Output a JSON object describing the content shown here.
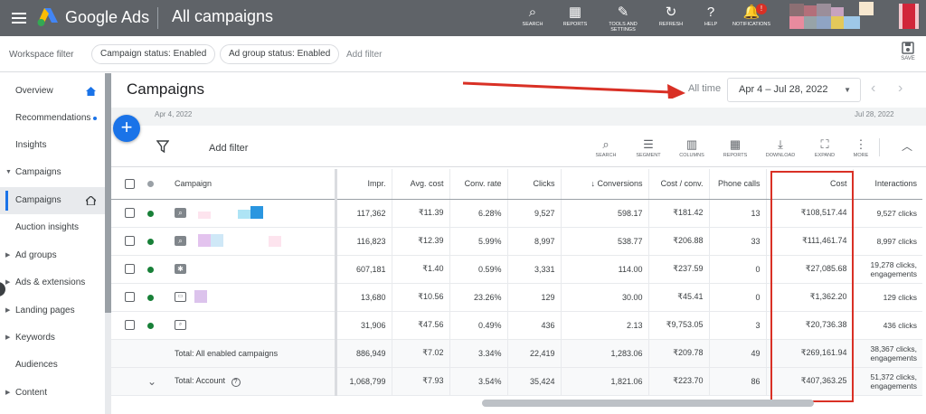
{
  "topbar": {
    "brand": "Google Ads",
    "page_title": "All campaigns",
    "icons": [
      {
        "label": "SEARCH",
        "glyph": "⌕"
      },
      {
        "label": "REPORTS",
        "glyph": "▦"
      },
      {
        "label": "TOOLS AND SETTINGS",
        "glyph": "✎"
      },
      {
        "label": "REFRESH",
        "glyph": "↻"
      },
      {
        "label": "HELP",
        "glyph": "?"
      },
      {
        "label": "NOTIFICATIONS",
        "glyph": "🔔"
      }
    ],
    "notification_count": "!"
  },
  "filterbar": {
    "workspace_filter": "Workspace filter",
    "chips": [
      "Campaign status: Enabled",
      "Ad group status: Enabled"
    ],
    "add_filter": "Add filter",
    "save_label": "SAVE"
  },
  "sidebar": {
    "items": [
      {
        "label": "Overview"
      },
      {
        "label": "Recommendations"
      },
      {
        "label": "Insights"
      },
      {
        "label": "Campaigns"
      },
      {
        "label": "Campaigns"
      },
      {
        "label": "Auction insights"
      },
      {
        "label": "Ad groups"
      },
      {
        "label": "Ads & extensions"
      },
      {
        "label": "Landing pages"
      },
      {
        "label": "Keywords"
      },
      {
        "label": "Audiences"
      },
      {
        "label": "Content"
      }
    ]
  },
  "main": {
    "title": "Campaigns",
    "all_time": "All time",
    "date_range": "Apr 4 – Jul 28, 2022",
    "chart_start": "Apr 4, 2022",
    "chart_end": "Jul 28, 2022",
    "add_filter": "Add filter",
    "toolbar": [
      "SEARCH",
      "SEGMENT",
      "COLUMNS",
      "REPORTS",
      "DOWNLOAD",
      "EXPAND",
      "MORE"
    ]
  },
  "table": {
    "headers": {
      "campaign": "Campaign",
      "impr": "Impr.",
      "avg_cost": "Avg. cost",
      "conv_rate": "Conv. rate",
      "clicks": "Clicks",
      "conversions": "Conversions",
      "cost_conv": "Cost / conv.",
      "phone_calls": "Phone calls",
      "cost": "Cost",
      "interactions": "Interactions"
    },
    "rows": [
      {
        "impr": "117,362",
        "avg_cost": "₹11.39",
        "conv_rate": "6.28%",
        "clicks": "9,527",
        "conversions": "598.17",
        "cost_conv": "₹181.42",
        "phone_calls": "13",
        "cost": "₹108,517.44",
        "interactions": "9,527 clicks"
      },
      {
        "impr": "116,823",
        "avg_cost": "₹12.39",
        "conv_rate": "5.99%",
        "clicks": "8,997",
        "conversions": "538.77",
        "cost_conv": "₹206.88",
        "phone_calls": "33",
        "cost": "₹111,461.74",
        "interactions": "8,997 clicks"
      },
      {
        "impr": "607,181",
        "avg_cost": "₹1.40",
        "conv_rate": "0.59%",
        "clicks": "3,331",
        "conversions": "114.00",
        "cost_conv": "₹237.59",
        "phone_calls": "0",
        "cost": "₹27,085.68",
        "interactions": "19,278 clicks, engagements"
      },
      {
        "impr": "13,680",
        "avg_cost": "₹10.56",
        "conv_rate": "23.26%",
        "clicks": "129",
        "conversions": "30.00",
        "cost_conv": "₹45.41",
        "phone_calls": "0",
        "cost": "₹1,362.20",
        "interactions": "129 clicks"
      },
      {
        "impr": "31,906",
        "avg_cost": "₹47.56",
        "conv_rate": "0.49%",
        "clicks": "436",
        "conversions": "2.13",
        "cost_conv": "₹9,753.05",
        "phone_calls": "3",
        "cost": "₹20,736.38",
        "interactions": "436 clicks"
      }
    ],
    "totals": [
      {
        "label": "Total: All enabled campaigns",
        "impr": "886,949",
        "avg_cost": "₹7.02",
        "conv_rate": "3.34%",
        "clicks": "22,419",
        "conversions": "1,283.06",
        "cost_conv": "₹209.78",
        "phone_calls": "49",
        "cost": "₹269,161.94",
        "interactions": "38,367 clicks, engagements"
      },
      {
        "label": "Total: Account",
        "impr": "1,068,799",
        "avg_cost": "₹7.93",
        "conv_rate": "3.54%",
        "clicks": "35,424",
        "conversions": "1,821.06",
        "cost_conv": "₹223.70",
        "phone_calls": "86",
        "cost": "₹407,363.25",
        "interactions": "51,372 clicks, engagements"
      }
    ]
  },
  "colors": {
    "topbar": "#5f6368",
    "accent": "#1a73e8",
    "status_green": "#188038",
    "annotation_red": "#d93025"
  }
}
